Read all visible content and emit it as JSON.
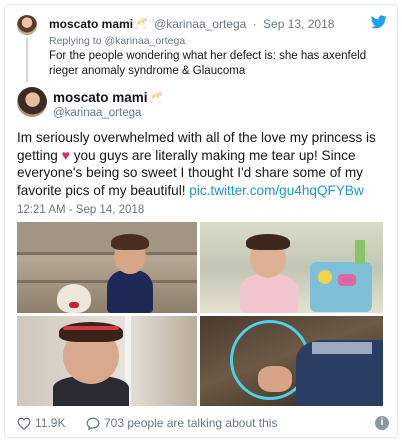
{
  "parent_tweet": {
    "display_name": "moscato mami",
    "name_emoji": "🥂",
    "handle": "@karinaa_ortega",
    "separator": "·",
    "date": "Sep 13, 2018",
    "replying_to_prefix": "Replying to",
    "replying_to_handle": "@karinaa_ortega",
    "text": "For the people wondering what her defect is: she has axenfeld rieger anomaly syndrome & Glaucoma"
  },
  "main_tweet": {
    "display_name": "moscato mami",
    "name_emoji": "🥂",
    "handle": "@karinaa_ortega",
    "text_part1": "Im seriously overwhelmed with all of the love my princess is getting",
    "heart": "♥",
    "text_part2": "you guys are literally making me tear up! Since everyone's being so sweet I thought I'd share some of my favorite pics of my beautiful!",
    "link": "pic.twitter.com/gu4hqQFYBw",
    "timestamp": "12:21 AM - Sep 14, 2018"
  },
  "footer": {
    "likes": "11.9K",
    "talking": "703 people are talking about this"
  },
  "colors": {
    "brand": "#1da1f2",
    "link": "#1b95e0",
    "heart": "#e0245e",
    "muted": "#657786"
  },
  "icons": {
    "logo": "twitter-bird-icon",
    "like": "heart-outline-icon",
    "reply": "speech-bubble-icon",
    "info": "info-icon"
  }
}
